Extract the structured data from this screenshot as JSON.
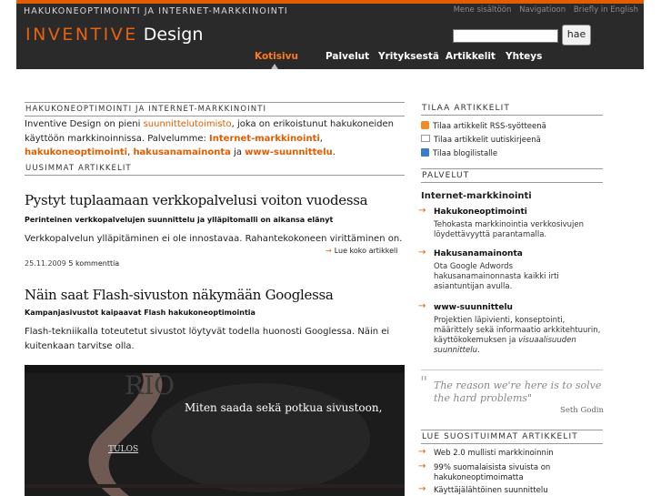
{
  "header": {
    "tagline": "HAKUKONEOPTIMOINTI JA INTERNET-MARKKINOINTI",
    "top_links": [
      "Mene sisältöön",
      "Navigatioon",
      "Briefly in English"
    ],
    "logo_brand": "INVENTIVE",
    "logo_rest": "Design",
    "search": {
      "value": "",
      "button": "hae"
    },
    "nav": [
      "Kotisivu",
      "Palvelut",
      "Yrityksestä",
      "Artikkelit",
      "Yhteys"
    ],
    "active_nav": "Kotisivu"
  },
  "intro": {
    "heading": "HAKUKONEOPTIMOINTI JA INTERNET-MARKKINOINTI",
    "t1": "Inventive Design on pieni ",
    "link1": "suunnittelutoimisto",
    "t2": ", joka on erikoistunut hakukoneiden käyttöön markkinoinnissa. Palvelumme: ",
    "link2": "Internet-markkinointi",
    "t3": ", ",
    "link3": "hakukoneoptimointi",
    "t4": ", ",
    "link4": "hakusanamainonta",
    "t5": " ja ",
    "link5": "www-suunnittelu",
    "t6": "."
  },
  "latest": {
    "heading": "UUSIMMAT ARTIKKELIT",
    "articles": [
      {
        "title": "Pystyt tuplaamaan verkkopalvelusi voiton vuodessa",
        "subtitle": "Perinteinen verkkopalvelujen suunnittelu ja ylläpitomalli on aikansa elänyt",
        "text": "Verkkopalvelun ylläpitäminen ei ole innostavaa. Rahantekokoneen virittäminen on.",
        "read_more": "Lue koko artikkeli",
        "date": "25.11.2009",
        "comments": "5 kommenttia"
      },
      {
        "title": "Näin saat Flash-sivuston näkymään Googlessa",
        "subtitle": "Kampanjasivustot kaipaavat Flash hakukoneoptimointia",
        "text": "Flash-tekniikalla toteutetut sivustot löytyvät todella huonosti Googlessa. Näin ei kuitenkaan tarvitse olla.",
        "image_caption": "Miten saada sekä potkua sivustoon,",
        "image_logo": "TULOS"
      }
    ]
  },
  "sidebar": {
    "subscribe_heading": "TILAA ARTIKKELIT",
    "subscribe": [
      {
        "icon": "rss-icon",
        "label": "Tilaa artikkelit RSS-syötteenä"
      },
      {
        "icon": "mail-icon",
        "label": "Tilaa artikkelit uutiskirjeenä"
      },
      {
        "icon": "checkbox-icon",
        "label": "Tilaa blogilistalle"
      }
    ],
    "services_heading": "PALVELUT",
    "services_main": "Internet-markkinointi",
    "services": [
      {
        "title": "Hakukoneoptimointi",
        "desc": "Tehokasta markkinointia verkkosivujen löydettävyyttä parantamalla."
      },
      {
        "title": "Hakusanamainonta",
        "desc": "Ota Google Adwords hakusanamainonnasta kaikki irti asiantuntijan avulla."
      },
      {
        "title": "www-suunnittelu",
        "desc": "Projektien läpivienti, konseptointi, määrittely sekä informaatio arkkitehtuurin, käyttökokemuksen ja ",
        "desc_em": "visuaalisuuden suunnittelu",
        "desc_end": "."
      }
    ],
    "quote": "The reason we're here is to solve the hard problems\"",
    "quote_author": "Seth Godin",
    "popular_heading": "LUE SUOSITUIMMAT ARTIKKELIT",
    "popular": [
      "Web 2.0 mullisti markkinoinnin",
      "99% suomalaisista sivuista on hakukoneoptimoimatta",
      "Käyttäjälähtöinen suunnittelu"
    ]
  },
  "colors": {
    "accent": "#e45c00",
    "header_bg": "#2a2a2a"
  }
}
